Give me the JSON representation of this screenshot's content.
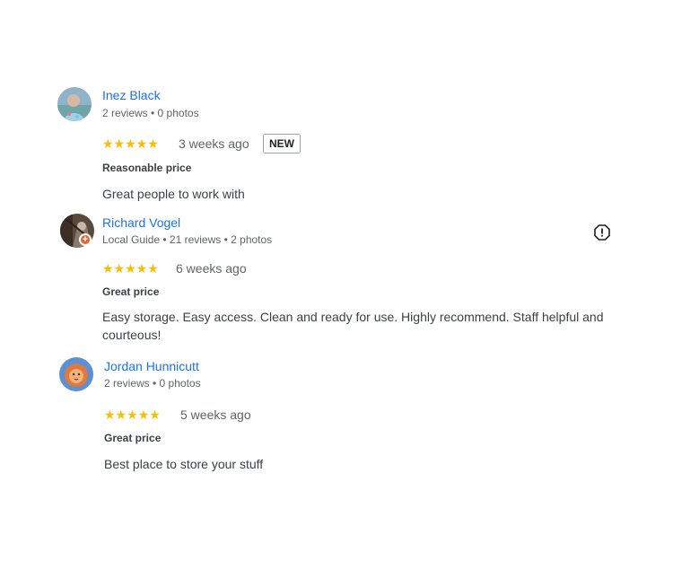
{
  "reviews": [
    {
      "name": "Inez Black",
      "meta": "2 reviews • 0 photos",
      "stars": "★★★★★",
      "rating": 5,
      "when": "3 weeks ago",
      "badge": "NEW",
      "price_label": "Reasonable price",
      "text": "Great people to work with"
    },
    {
      "name": "Richard Vogel",
      "meta": "Local Guide • 21 reviews • 2 photos",
      "stars": "★★★★★",
      "rating": 5,
      "when": "6 weeks ago",
      "price_label": "Great price",
      "text": "Easy storage. Easy access. Clean and ready for use. Highly recommend. Staff helpful and courteous!",
      "local_guide_badge": "+"
    },
    {
      "name": "Jordan Hunnicutt",
      "meta": "2 reviews • 0 photos",
      "stars": "★★★★★",
      "rating": 5,
      "when": "5 weeks ago",
      "price_label": "Great price",
      "text": "Best place to store your stuff"
    }
  ],
  "colors": {
    "name_link": "#1a73e8",
    "star": "#fbbc04",
    "guide_badge": "#e8632b"
  },
  "icons": {
    "report": "report-flag-icon"
  }
}
